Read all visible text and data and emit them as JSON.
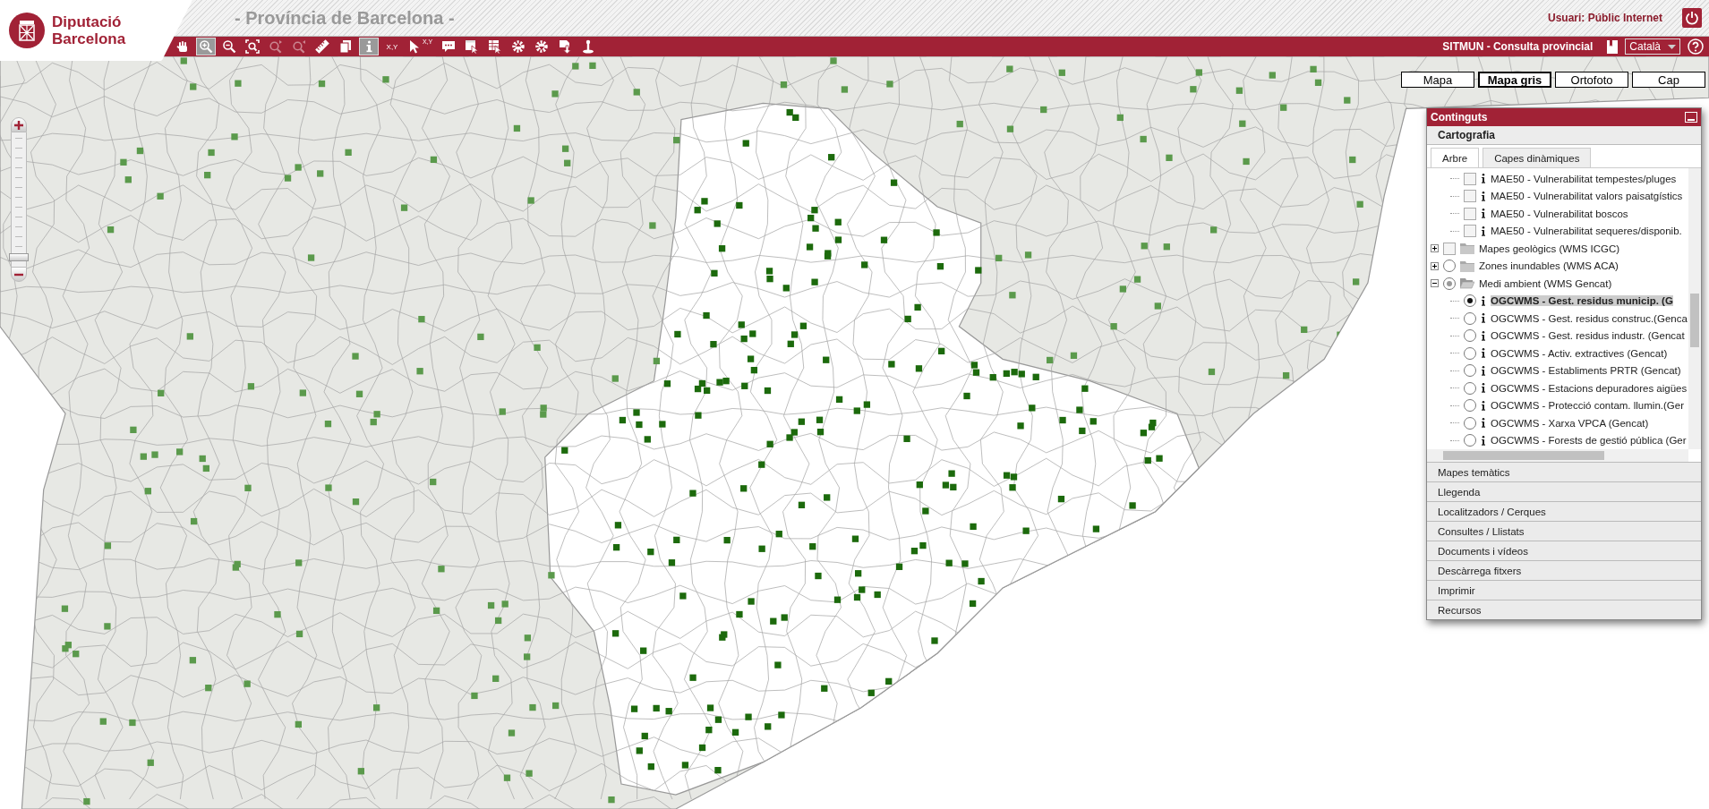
{
  "header": {
    "logo_lines": [
      "Diputació",
      "Barcelona"
    ],
    "subtitle": "- Província de Barcelona -",
    "user": "Usuari: Públic Internet",
    "app_title": "SITMUN - Consulta provincial",
    "language": "Català"
  },
  "toolbar": [
    {
      "kind": "pan",
      "selected": false,
      "disabled": false
    },
    {
      "kind": "zoom-in",
      "selected": true,
      "disabled": false
    },
    {
      "kind": "zoom-out",
      "selected": false,
      "disabled": false
    },
    {
      "kind": "zoom-extent",
      "selected": false,
      "disabled": false
    },
    {
      "kind": "zoom-previous",
      "selected": false,
      "disabled": true
    },
    {
      "kind": "zoom-next",
      "selected": false,
      "disabled": true
    },
    {
      "kind": "measure",
      "selected": false,
      "disabled": false
    },
    {
      "kind": "copy",
      "selected": false,
      "disabled": false
    },
    {
      "kind": "info",
      "selected": true,
      "disabled": false
    },
    {
      "kind": "coordinates",
      "label": "X,Y",
      "selected": false,
      "disabled": false
    },
    {
      "kind": "pointer-coordinates",
      "label": "X,Y",
      "selected": false,
      "disabled": false
    },
    {
      "kind": "comment",
      "selected": false,
      "disabled": false
    },
    {
      "kind": "select",
      "selected": false,
      "disabled": false
    },
    {
      "kind": "select-table",
      "selected": false,
      "disabled": false
    },
    {
      "kind": "gear-up",
      "selected": false,
      "disabled": false
    },
    {
      "kind": "gear-down",
      "selected": false,
      "disabled": false
    },
    {
      "kind": "download",
      "selected": false,
      "disabled": false
    },
    {
      "kind": "locate",
      "selected": false,
      "disabled": false
    }
  ],
  "zoom": {
    "level": 0.04
  },
  "base_layers": [
    {
      "label": "Mapa",
      "selected": false
    },
    {
      "label": "Mapa gris",
      "selected": true
    },
    {
      "label": "Ortofoto",
      "selected": false
    },
    {
      "label": "Cap",
      "selected": false
    }
  ],
  "panel": {
    "title": "Continguts",
    "section": "Cartografia",
    "tabs": [
      {
        "label": "Arbre",
        "selected": true
      },
      {
        "label": "Capes dinàmiques",
        "selected": false
      }
    ],
    "tree": [
      {
        "kind": "group",
        "children": [
          {
            "kind": "checkbox-layer",
            "label": "MAE50 - Vulnerabilitat tempestes/pluges",
            "checked": false,
            "selected": false
          },
          {
            "kind": "checkbox-layer",
            "label": "MAE50 - Vulnerabilitat valors paisatgístics",
            "checked": false,
            "selected": false
          },
          {
            "kind": "checkbox-layer",
            "label": "MAE50 - Vulnerabilitat boscos",
            "checked": false,
            "selected": false
          },
          {
            "kind": "checkbox-layer",
            "label": "MAE50 - Vulnerabilitat sequeres/disponib.",
            "checked": false,
            "selected": false
          }
        ]
      },
      {
        "kind": "checkbox-folder",
        "label": "Mapes geològics (WMS ICGC)",
        "checked": false,
        "expanded": false
      },
      {
        "kind": "radio-folder",
        "label": "Zones inundables (WMS ACA)",
        "checked": false,
        "expanded": false
      },
      {
        "kind": "radio-folder",
        "label": "Medi ambient (WMS Gencat)",
        "checked": true,
        "expanded": true,
        "children": [
          {
            "kind": "radio-layer",
            "label": "OGCWMS - Gest. residus municip. (G",
            "checked": true,
            "selected": true
          },
          {
            "kind": "radio-layer",
            "label": "OGCWMS - Gest. residus construc.(Genca",
            "checked": false,
            "selected": false
          },
          {
            "kind": "radio-layer",
            "label": "OGCWMS - Gest. residus industr. (Gencat",
            "checked": false,
            "selected": false
          },
          {
            "kind": "radio-layer",
            "label": "OGCWMS - Activ. extractives (Gencat)",
            "checked": false,
            "selected": false
          },
          {
            "kind": "radio-layer",
            "label": "OGCWMS - Establiments PRTR (Gencat)",
            "checked": false,
            "selected": false
          },
          {
            "kind": "radio-layer",
            "label": "OGCWMS - Estacions depuradores aigües",
            "checked": false,
            "selected": false
          },
          {
            "kind": "radio-layer",
            "label": "OGCWMS - Protecció contam. llumin.(Ger",
            "checked": false,
            "selected": false
          },
          {
            "kind": "radio-layer",
            "label": "OGCWMS - Xarxa VPCA (Gencat)",
            "checked": false,
            "selected": false
          },
          {
            "kind": "radio-layer",
            "label": "OGCWMS - Forests de gestió pública (Ger",
            "checked": false,
            "selected": false
          }
        ]
      }
    ],
    "sections": [
      "Mapes temàtics",
      "Llegenda",
      "Localitzadors / Cerques",
      "Consultes / Llistats",
      "Documents i vídeos",
      "Descàrrega fitxers",
      "Imprimir",
      "Recursos"
    ]
  }
}
